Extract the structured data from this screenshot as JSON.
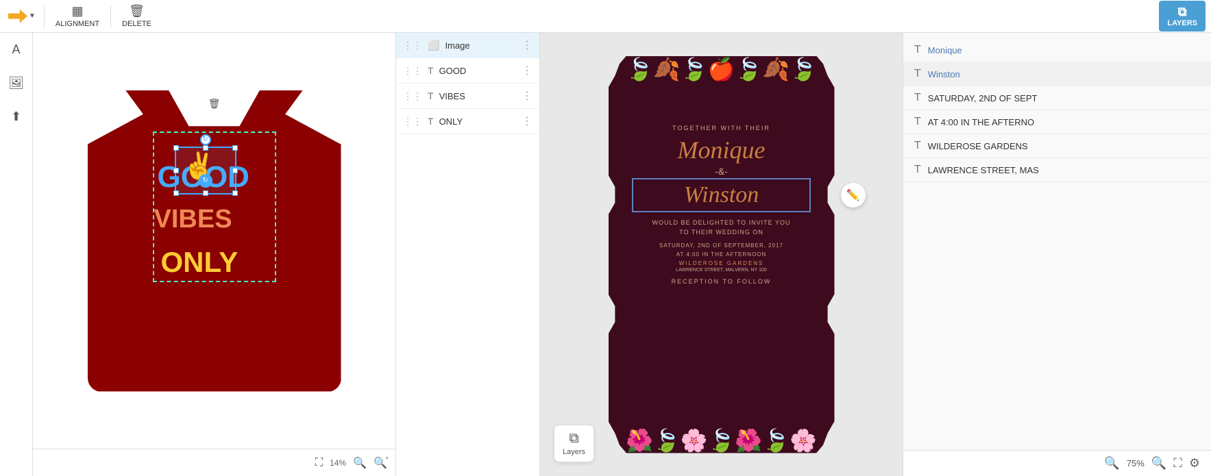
{
  "toolbar": {
    "alignment_label": "ALIGNMENT",
    "delete_label": "DELETE",
    "layers_label": "LAYERS"
  },
  "left_sidebar": {
    "icons": [
      "A",
      "🖼",
      "⬆"
    ]
  },
  "canvas": {
    "zoom_percent": "14%",
    "design_texts": {
      "good": "GOOD",
      "vibes": "VIBES",
      "only": "ONLY"
    }
  },
  "layers": [
    {
      "id": "image",
      "label": "Image",
      "type": "image",
      "active": true
    },
    {
      "id": "good",
      "label": "GOOD",
      "type": "text",
      "active": false
    },
    {
      "id": "vibes",
      "label": "VIBES",
      "type": "text",
      "active": false
    },
    {
      "id": "only",
      "label": "ONLY",
      "type": "text",
      "active": false
    }
  ],
  "wedding_card": {
    "together_text": "TOGETHER WITH THEIR",
    "monique": "Monique",
    "ampersand": "-&-",
    "winston": "Winston",
    "invite_text": "WOULD BE DELIGHTED TO INVITE YOU\nTO THEIR WEDDING ON",
    "date": "SATURDAY, 2ND OF SEPTEMBER, 2017",
    "time": "AT 4:00 IN THE AFTERNOON",
    "venue": "WILDEROSE GARDENS",
    "address": "LAWRENCE STREET, MALVERN, NY 100",
    "reception": "RECEPTION TO FOLLOW"
  },
  "right_panel": {
    "layers": [
      {
        "id": "monique",
        "label": "Monique",
        "type": "text",
        "active": false
      },
      {
        "id": "winston",
        "label": "Winston",
        "type": "text",
        "active": true
      },
      {
        "id": "saturday",
        "label": "SATURDAY, 2ND OF SEPT",
        "type": "text",
        "active": false
      },
      {
        "id": "at400",
        "label": "AT 4:00 IN THE AFTERNO",
        "type": "text",
        "active": false
      },
      {
        "id": "wilderose",
        "label": "WILDEROSE GARDENS",
        "type": "text",
        "active": false
      },
      {
        "id": "lawrence",
        "label": "LAWRENCE STREET, MAS",
        "type": "text",
        "active": false
      }
    ]
  },
  "bottom_bar": {
    "zoom_percent": "75%"
  }
}
